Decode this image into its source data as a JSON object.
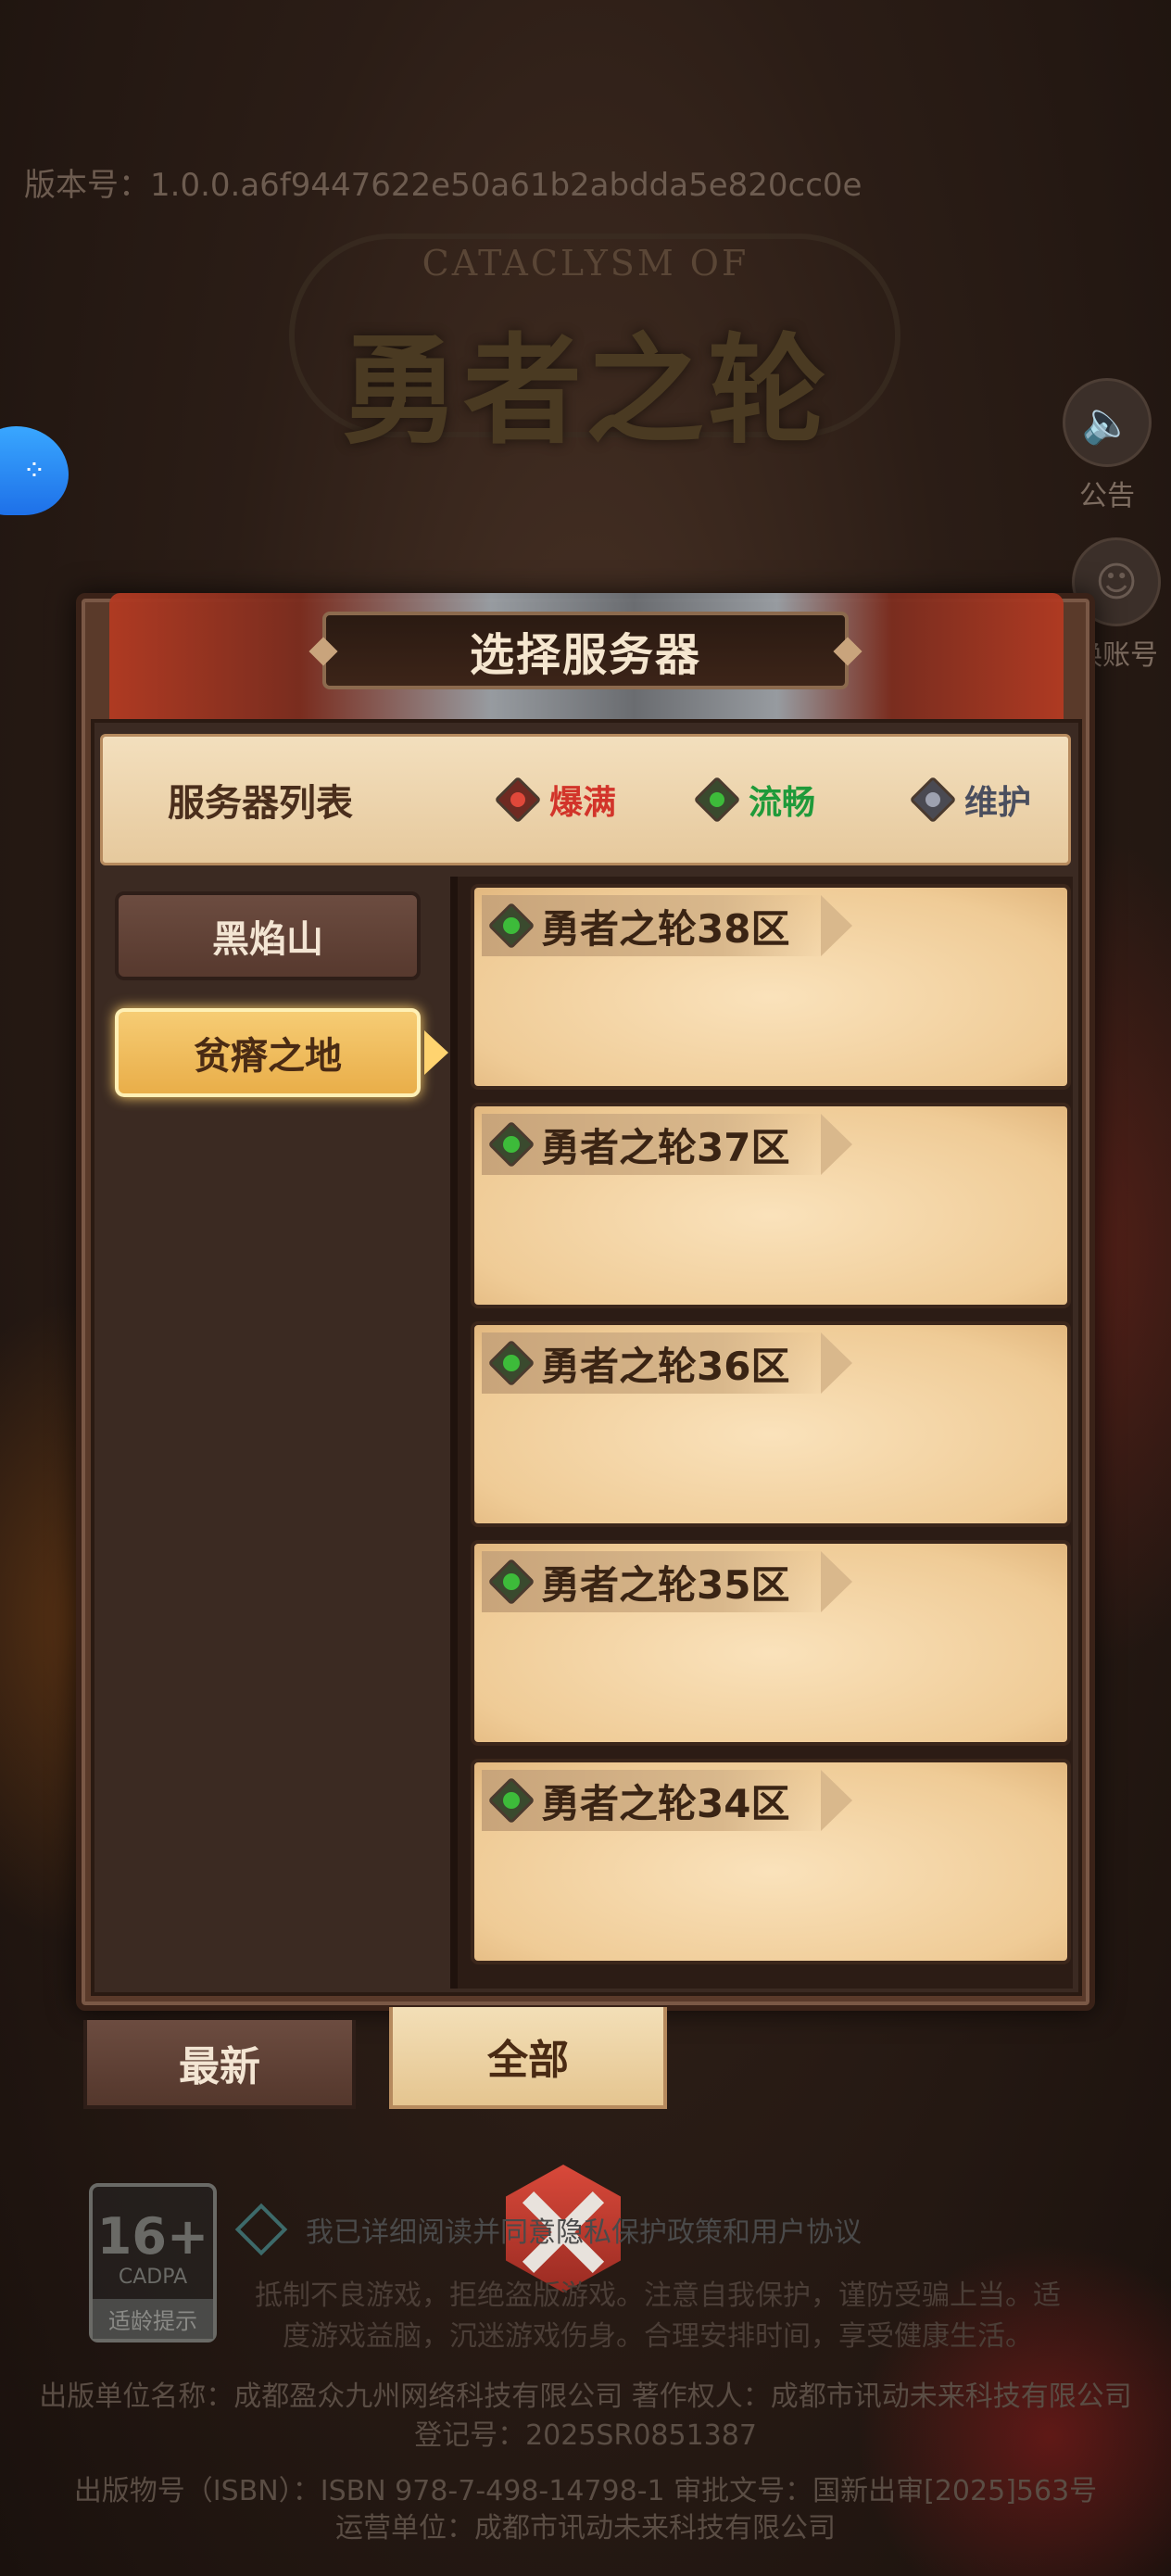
{
  "version_text": "版本号：1.0.0.a6f9447622e50a61b2abdda5e820cc0e",
  "logo": {
    "subtitle": "CATACLYSM OF",
    "title": "勇者之轮"
  },
  "side_buttons": {
    "announcement": "公告",
    "switch_account": "换账号"
  },
  "dialog": {
    "title": "选择服务器",
    "legend": {
      "title": "服务器列表",
      "items": [
        {
          "label": "爆满",
          "color": "#d2342a"
        },
        {
          "label": "流畅",
          "color": "#1f9a3a"
        },
        {
          "label": "维护",
          "color": "#6b6e7a"
        }
      ]
    },
    "regions": [
      {
        "label": "黑焰山",
        "selected": false
      },
      {
        "label": "贫瘠之地",
        "selected": true
      }
    ],
    "servers": [
      {
        "name": "勇者之轮38区",
        "status": "流畅"
      },
      {
        "name": "勇者之轮37区",
        "status": "流畅"
      },
      {
        "name": "勇者之轮36区",
        "status": "流畅"
      },
      {
        "name": "勇者之轮35区",
        "status": "流畅"
      },
      {
        "name": "勇者之轮34区",
        "status": "流畅"
      }
    ],
    "tabs": {
      "latest": "最新",
      "all": "全部"
    }
  },
  "age_rating": {
    "value": "16+",
    "org": "CADPA",
    "label": "适龄提示"
  },
  "agreement_text": "我已详细阅读并同意隐私保护政策和用户协议",
  "health_notice": [
    "抵制不良游戏，拒绝盗版游戏。注意自我保护，谨防受骗上当。适",
    "度游戏益脑，沉迷游戏伤身。合理安排时间，享受健康生活。"
  ],
  "footer": {
    "publisher": "出版单位名称：成都盈众九州网络科技有限公司 著作权人：成都市讯动未来科技有限公司",
    "registration": "登记号：2025SR0851387",
    "isbn": "出版物号（ISBN）：ISBN 978-7-498-14798-1 审批文号：国新出审[2025]563号",
    "operator": "运营单位：成都市讯动未来科技有限公司"
  }
}
